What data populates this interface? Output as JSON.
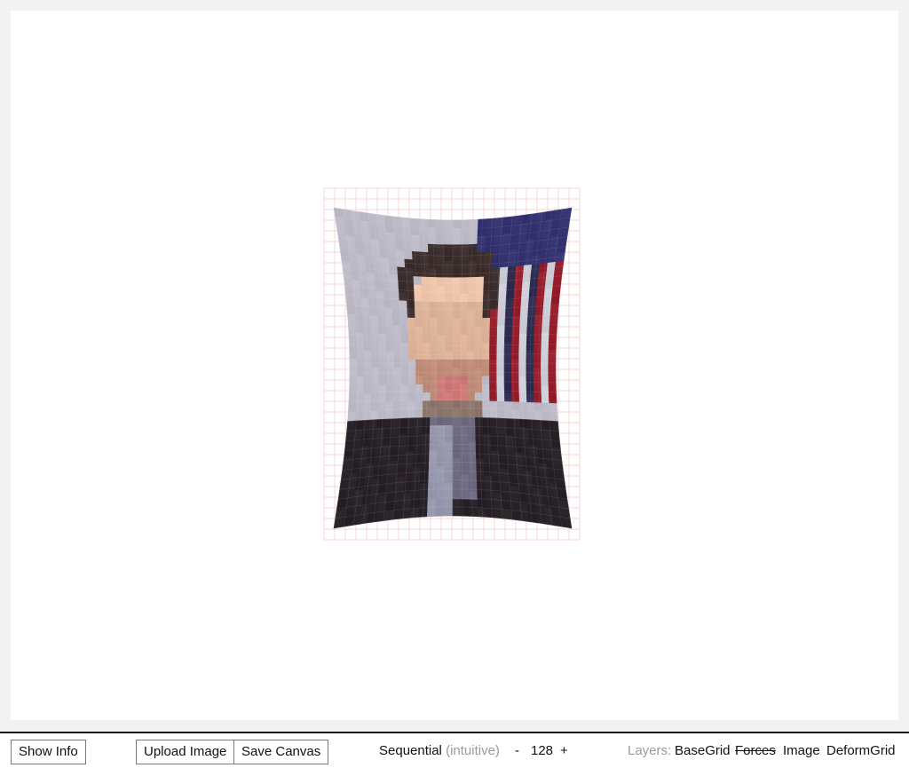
{
  "toolbar": {
    "show_info_label": "Show Info",
    "upload_image_label": "Upload Image",
    "save_canvas_label": "Save Canvas",
    "mode_label": "Sequential",
    "mode_hint": "(intuitive)",
    "decrement_label": "-",
    "count_value": "128",
    "increment_label": "+",
    "layers_label": "Layers:",
    "layers": [
      {
        "label": "BaseGrid",
        "enabled": true
      },
      {
        "label": "Forces",
        "enabled": false
      },
      {
        "label": "Image",
        "enabled": true
      },
      {
        "label": "DeformGrid",
        "enabled": true
      }
    ]
  },
  "colors": {
    "background": "#f2f2f2",
    "panel": "#ffffff",
    "grid_line": "#f3c9c9",
    "button_border": "#7a7a7a",
    "muted_text": "#9a9a9a"
  }
}
